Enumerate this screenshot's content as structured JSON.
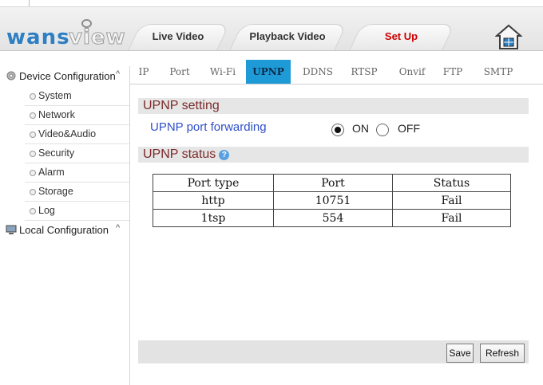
{
  "header": {
    "logo_text_1": "wans",
    "logo_text_2": "view",
    "tabs": [
      {
        "label": "Live Video"
      },
      {
        "label": "Playback Video"
      },
      {
        "label": "Set Up"
      }
    ],
    "active_tab": "Set Up"
  },
  "sidebar": {
    "device_configuration": "Device Configuration",
    "device_items": [
      {
        "label": "System"
      },
      {
        "label": "Network"
      },
      {
        "label": "Video&Audio"
      },
      {
        "label": "Security"
      },
      {
        "label": "Alarm"
      },
      {
        "label": "Storage"
      },
      {
        "label": "Log"
      }
    ],
    "local_configuration": "Local Configuration"
  },
  "subtabs": [
    {
      "label": "IP"
    },
    {
      "label": "Port"
    },
    {
      "label": "Wi-Fi"
    },
    {
      "label": "UPNP"
    },
    {
      "label": "DDNS"
    },
    {
      "label": "RTSP"
    },
    {
      "label": "Onvif"
    },
    {
      "label": "FTP"
    },
    {
      "label": "SMTP"
    }
  ],
  "active_subtab": "UPNP",
  "upnp": {
    "setting_title": "UPNP setting",
    "port_forwarding_label": "UPNP port forwarding",
    "on_label": "ON",
    "off_label": "OFF",
    "selected": "ON",
    "status_title": "UPNP status",
    "help_glyph": "?",
    "table": {
      "headers": [
        "Port type",
        "Port",
        "Status"
      ],
      "rows": [
        [
          "http",
          "10751",
          "Fail"
        ],
        [
          "1tsp",
          "554",
          "Fail"
        ]
      ]
    }
  },
  "buttons": {
    "save": "Save",
    "refresh": "Refresh"
  },
  "colors": {
    "accent": "#1e9ad6",
    "active_nav": "#cc0000",
    "link_blue": "#2f4fc9",
    "section_title": "#7b2a2a"
  }
}
